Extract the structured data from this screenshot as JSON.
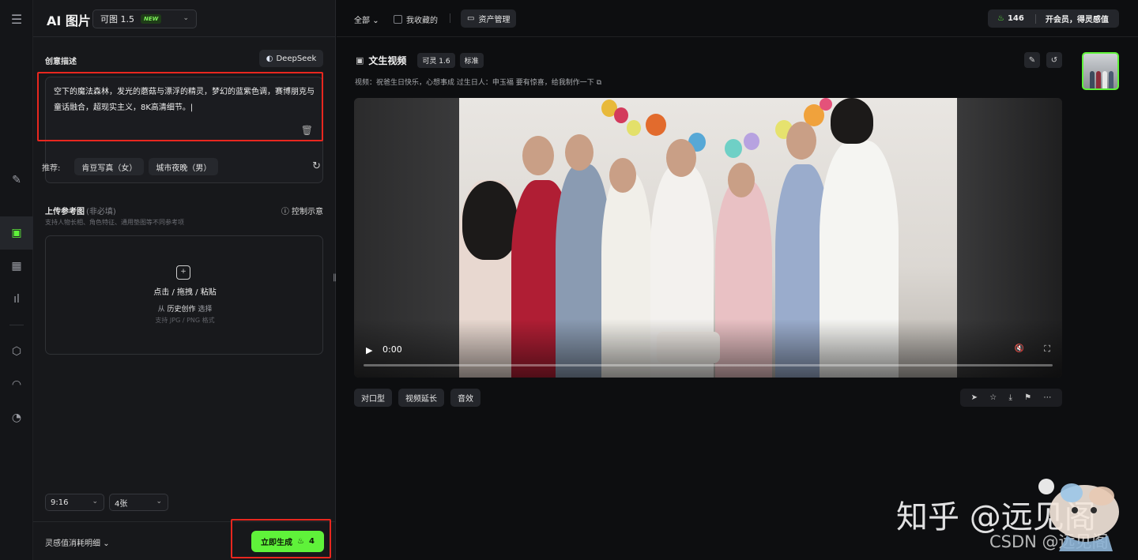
{
  "app": {
    "title": "AI 图片",
    "model": "可图 1.5",
    "model_badge": "NEW"
  },
  "rail": {
    "icons": [
      "menu-icon",
      "magic-wand-icon",
      "image-icon",
      "video-icon",
      "audio-wave-icon",
      "box-icon",
      "eye-icon",
      "history-icon"
    ]
  },
  "prompt": {
    "label": "创意描述",
    "deepseek_label": "DeepSeek",
    "text": "空下的魔法森林，发光的蘑菇与漂浮的精灵，梦幻的蓝紫色调，赛博朋克与童话融合，超现实主义，8K高清细节。|",
    "recommend_label": "推荐:",
    "chips": [
      "肯豆写真（女）",
      "城市夜晚（男）"
    ]
  },
  "upload": {
    "title": "上传参考图",
    "optional": "(非必填)",
    "subtitle": "支持人物长相、角色特征、通用垫图等不同参考项",
    "hint": "控制示意",
    "line1": "点击 / 拖拽 / 粘贴",
    "line2_prefix": "从",
    "line2_link": "历史创作",
    "line2_suffix": "选择",
    "line3": "支持 JPG / PNG 格式"
  },
  "options": {
    "ratio": "9:16",
    "count": "4张"
  },
  "bottom": {
    "cost_label": "灵感值消耗明细",
    "generate_label": "立即生成",
    "generate_cost": "4"
  },
  "topbar": {
    "filter_all": "全部",
    "favorites": "我收藏的",
    "assets": "资产管理",
    "points": "146",
    "vip": "开会员，得灵感值"
  },
  "task": {
    "title": "文生视频",
    "model_tag": "可灵 1.6",
    "quality_tag": "标准",
    "description": "视频：祝爸生日快乐，心想事成 过生日人：申玉福 要有惊喜，给我制作一下"
  },
  "video": {
    "time": "0:00",
    "progress": 0
  },
  "video_actions": [
    "对口型",
    "视频延长",
    "音效"
  ],
  "tool_icons": [
    "send-icon",
    "star-icon",
    "download-icon",
    "flag-icon",
    "more-icon"
  ],
  "watermark": {
    "zhihu": "知乎 @远见阁",
    "csdn": "CSDN @远见阁"
  },
  "colors": {
    "accent": "#5ff23a",
    "highlight_box": "#e8271f",
    "panel_bg": "#17181b",
    "main_bg": "#0d0e10"
  }
}
